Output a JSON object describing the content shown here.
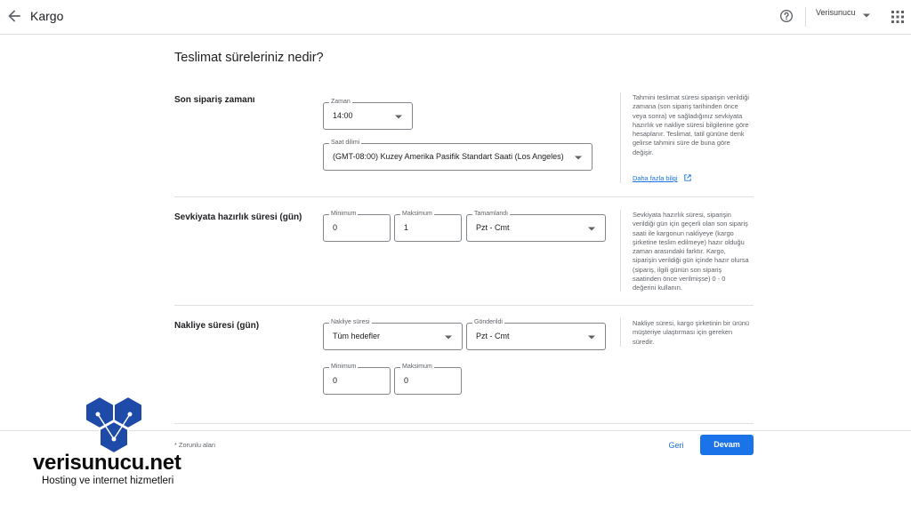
{
  "header": {
    "title": "Kargo",
    "account": "Verisunucu"
  },
  "main": {
    "heading": "Teslimat süreleriniz nedir?"
  },
  "sections": {
    "cutoff": {
      "title": "Son sipariş zamanı",
      "time_label": "Zaman",
      "time_value": "14:00",
      "tz_label": "Saat dilimi",
      "tz_value": "(GMT-08:00) Kuzey Amerika Pasifik Standart Saati (Los Angeles)",
      "help": "Tahmini teslimat süresi siparişin verildiği zamana (son sipariş tarihinden önce veya sonra) ve sağladığınız sevkiyata hazırlık ve nakliye süresi bilgilerine göre hesaplanır. Teslimat, tatil gününe denk gelirse tahmini süre de buna göre değişir.",
      "help_link": "Daha fazla bilgi"
    },
    "handling": {
      "title": "Sevkiyata hazırlık süresi (gün)",
      "min_label": "Minimum",
      "min_value": "0",
      "max_label": "Maksimum",
      "max_value": "1",
      "days_label": "Tamamlandı",
      "days_value": "Pzt - Cmt",
      "help": "Sevkiyata hazırlık süresi, siparişin verildiği gün için geçerli olan son sipariş saati ile kargonun nakliyeye (kargo şirketine teslim edilmeye) hazır olduğu zaman arasındaki farktır. Kargo, siparişin verildiği gün içinde hazır olursa (sipariş, ilgili günün son sipariş saatinden önce verilmişse) 0 - 0 değerini kullanın."
    },
    "transit": {
      "title": "Nakliye süresi (gün)",
      "transit_label": "Nakliye süresi",
      "transit_value": "Tüm hedefler",
      "days_label": "Gönderildi",
      "days_value": "Pzt - Cmt",
      "min_label": "Minimum",
      "min_value": "0",
      "max_label": "Maksimum",
      "max_value": "0",
      "help": "Nakliye süresi, kargo şirketinin bir ürünü müşteriye ulaştırması için gereken süredir."
    }
  },
  "footer": {
    "required_note": "* Zorunlu alan",
    "back_label": "Geri",
    "next_label": "Devam"
  },
  "watermark": {
    "brand": "verisunucu.net",
    "tagline": "Hosting ve internet hizmetleri"
  },
  "colors": {
    "accent": "#1a73e8",
    "watermark_blue": "#1e4aa8"
  },
  "icons": [
    "arrow-back-icon",
    "help-icon",
    "chevron-down-icon",
    "apps-grid-icon",
    "open-in-new-icon"
  ]
}
